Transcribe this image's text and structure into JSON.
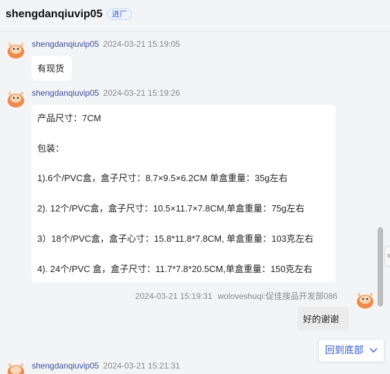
{
  "header": {
    "title": "shengdanqiuvip05",
    "badge": "进厂"
  },
  "messages": [
    {
      "sender": "shengdanqiuvip05",
      "time": "2024-03-21 15:19:05",
      "lines": [
        "有现货"
      ]
    },
    {
      "sender": "shengdanqiuvip05",
      "time": "2024-03-21 15:19:26",
      "lines": [
        "产品尺寸：7CM",
        "包装：",
        "1).6个/PVC盒，盒子尺寸：8.7×9.5×6.2CM  单盒重量：35g左右",
        "2). 12个/PVC盒，盒子尺寸：10.5×11.7×7.8CM,单盒重量：75g左右",
        "3）18个/PVC盒，盒子心寸：15.8*11.8*7.8CM, 单盒重量：103克左右",
        "4).  24个/PVC 盒，盒子尺寸：11.7*7.8*20.5CM,单盒重量：150克左右"
      ]
    },
    {
      "sender": "woloveshuqi:促佳搜品开发部086",
      "time": "2024-03-21 15:19:31",
      "lines": [
        "好的谢谢"
      ]
    },
    {
      "sender": "shengdanqiuvip05",
      "time": "2024-03-21 15:21:31",
      "lines": []
    }
  ],
  "back_to_bottom": "回到底部",
  "colors": {
    "accent": "#2f5bd7",
    "sender_name": "#3a4fa0",
    "avatar": "#f08a4b"
  }
}
